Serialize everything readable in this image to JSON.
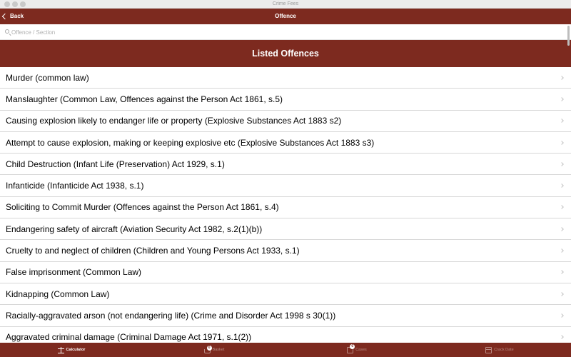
{
  "window": {
    "title": "Crime Fees"
  },
  "navbar": {
    "back_label": "Back",
    "title": "Offence"
  },
  "search": {
    "placeholder": "Offence / Section",
    "value": ""
  },
  "section": {
    "title": "Listed Offences"
  },
  "offences": [
    "Murder (common law)",
    "Manslaughter (Common Law, Offences against the Person Act 1861, s.5)",
    "Causing explosion likely to endanger life or property (Explosive Substances Act 1883 s2)",
    "Attempt to cause explosion, making or keeping explosive etc (Explosive Substances Act 1883 s3)",
    "Child Destruction (Infant Life (Preservation) Act 1929, s.1)",
    "Infanticide (Infanticide Act 1938, s.1)",
    "Soliciting to Commit Murder (Offences against the Person Act 1861, s.4)",
    "Endangering safety of aircraft (Aviation Security Act 1982, s.2(1)(b))",
    "Cruelty to and neglect of children (Children and Young Persons Act 1933, s.1)",
    "False imprisonment (Common Law)",
    "Kidnapping (Common Law)",
    "Racially-aggravated arson (not endangering life) (Crime and Disorder Act 1998 s 30(1))",
    "Aggravated criminal damage (Criminal Damage Act 1971, s.1(2))"
  ],
  "tabs": [
    {
      "label": "Calculator",
      "icon": "scales-icon",
      "active": true
    },
    {
      "label": "Basket",
      "icon": "basket-icon",
      "badge": "0",
      "active": false
    },
    {
      "label": "Cases",
      "icon": "cases-icon",
      "badge": "0",
      "active": false
    },
    {
      "label": "Crack Date",
      "icon": "calendar-icon",
      "active": false
    }
  ],
  "colors": {
    "brand": "#7d2a1f",
    "inactive_tab": "#b98a82"
  }
}
